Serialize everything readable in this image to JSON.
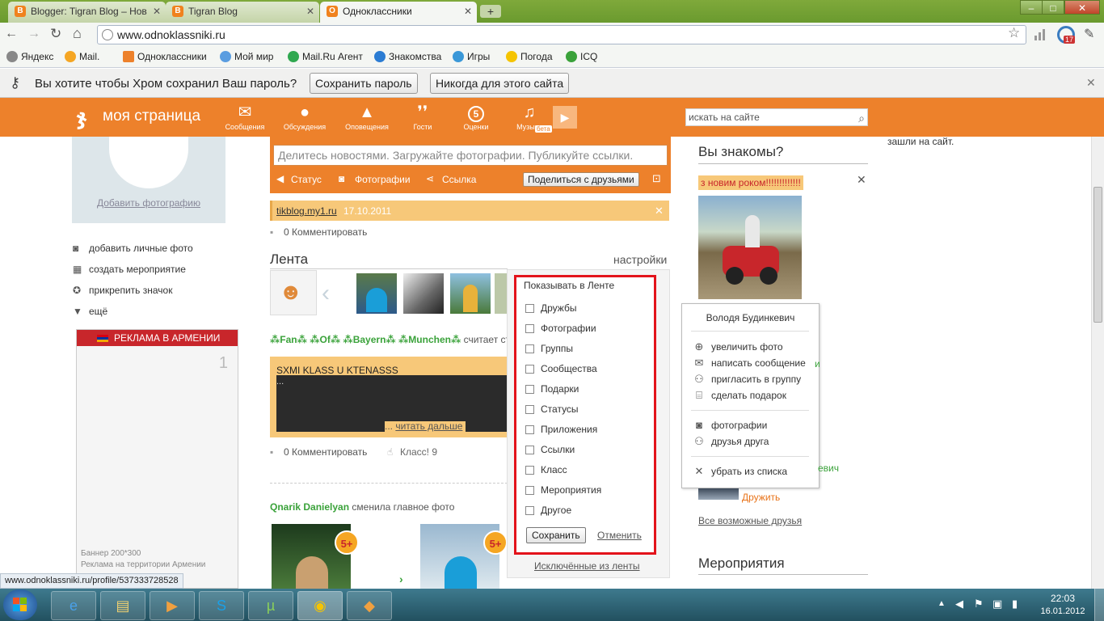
{
  "browser": {
    "tabs": [
      {
        "label": "Blogger: Tigran Blog – Нов",
        "active": false
      },
      {
        "label": "Tigran Blog",
        "active": false
      },
      {
        "label": "Одноклассники",
        "active": true
      }
    ],
    "url": "www.odnoklassniki.ru",
    "bookmarks": [
      "Яндекс",
      "Mail.",
      "Одноклассники",
      "Мой мир",
      "Mail.Ru Агент",
      "Знакомства",
      "Игры",
      "Погода",
      "ICQ"
    ],
    "badge_count": "17",
    "password_bar": {
      "question": "Вы хотите чтобы Хром сохранил Ваш пароль?",
      "save": "Сохранить пароль",
      "never": "Никогда для этого сайта"
    },
    "status_url": "www.odnoklassniki.ru/profile/537333728528"
  },
  "header": {
    "title": "моя страница",
    "nav": [
      "Сообщения",
      "Обсуждения",
      "Оповещения",
      "Гости",
      "Оценки",
      "Музыка"
    ],
    "ratings_count": "5",
    "beta": "бета",
    "search_placeholder": "искать на сайте"
  },
  "left": {
    "add_photo": "Добавить фотографию",
    "links": [
      "добавить личные фото",
      "создать мероприятие",
      "прикрепить значок",
      "ещё"
    ],
    "ad_header": "РЕКЛАМА В АРМЕНИИ",
    "ad_number": "1",
    "ad_footer_1": "Баннер 200*300",
    "ad_footer_2": "Реклама на территории Армении"
  },
  "center": {
    "share_placeholder": "Делитесь новостями. Загружайте фотографии. Публикуйте ссылки.",
    "share_options": [
      "Статус",
      "Фотографии",
      "Ссылка"
    ],
    "share_button": "Поделиться с друзьями",
    "notice_link": "tikblog.my1.ru",
    "notice_date": "17.10.2011",
    "comment": "0 Комментировать",
    "feed_title": "Лента",
    "settings": "настройки",
    "post1_author": "⁂Fan⁂ ⁂Of⁂ ⁂Bayern⁂ ⁂Munchen⁂",
    "post1_action": "считает стат",
    "post1_title": "SXMI KLASS U KTENASSS",
    "post1_dots": "...",
    "post1_more_prefix": "... ",
    "post1_more": "читать дальше",
    "post1_comment": "0 Комментировать",
    "post1_class": "Класс! 9",
    "post2_author": "Qnarik Danielyan",
    "post2_action": "сменила главное фото",
    "badge": "5+"
  },
  "feed_dropdown": {
    "title": "Показывать в Ленте",
    "options": [
      "Дружбы",
      "Фотографии",
      "Группы",
      "Сообщества",
      "Подарки",
      "Статусы",
      "Приложения",
      "Ссылки",
      "Класс",
      "Мероприятия",
      "Другое"
    ],
    "save": "Сохранить",
    "cancel": "Отменить",
    "excluded": "Исключённые из ленты"
  },
  "right": {
    "top_text": "зашли на сайт.",
    "title": "Вы знакомы?",
    "photo_caption": "з новим роком!!!!!!!!!!!!!",
    "popup": {
      "name": "Володя Будинкевич",
      "items1": [
        "увеличить фото",
        "написать сообщение",
        "пригласить в группу",
        "сделать подарок"
      ],
      "items2": [
        "фотографии",
        "друзья друга"
      ],
      "remove": "убрать из списка"
    },
    "partial_name": "евич",
    "befriend": "Дружить",
    "all_friends": "Все возможные друзья",
    "events": "Мероприятия"
  },
  "taskbar": {
    "time": "22:03",
    "date": "16.01.2012"
  }
}
